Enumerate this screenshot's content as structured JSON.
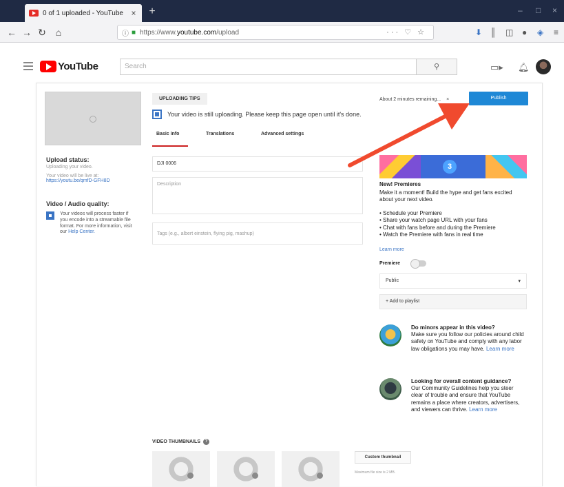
{
  "browser": {
    "tab_title": "0 of 1 uploaded - YouTube",
    "tab_close": "×",
    "new_tab": "+",
    "url_scheme": "https://www.",
    "url_host": "youtube.com",
    "url_path": "/upload",
    "url_tools": "··· ♡ ☆",
    "window_controls": [
      "–",
      "□",
      "×"
    ]
  },
  "yt_header": {
    "logo_text": "YouTube",
    "search_placeholder": "Search",
    "search_icon": "search-icon"
  },
  "left_panel": {
    "upload_status_label": "Upload status:",
    "upload_status_text": "Uploading your video.",
    "live_text": "Your video will be live at:",
    "live_link": "https://youtu.be/qmfD-GFH8D",
    "quality_title": "Video / Audio quality:",
    "quality_text": "Your videos will process faster if you encode into a streamable file format. For more information, visit our",
    "quality_link": "Help Center."
  },
  "upload": {
    "tip_label": "UPLOADING TIPS",
    "uploading_message": "Your video is still uploading. Please keep this page open until it's done.",
    "time_remaining": "About 2 minutes remaining...",
    "close_label": "×",
    "publish_label": "Publish",
    "tabs": [
      "Basic info",
      "Translations",
      "Advanced settings"
    ]
  },
  "form": {
    "title_value": "DJI 0006",
    "description_placeholder": "Description",
    "tags_placeholder": "Tags (e.g., albert einstein, flying pig, mashup)"
  },
  "premiere": {
    "banner_number": "3",
    "title": "New! Premieres",
    "description": "Make it a moment! Build the hype and get fans excited about your next video.",
    "items": [
      "• Schedule your Premiere",
      "• Share your watch page URL with your fans",
      "• Chat with fans before and during the Premiere",
      "• Watch the Premiere with fans in real time"
    ],
    "learn_more": "Learn more",
    "toggle_label": "Premiere",
    "privacy_value": "Public",
    "privacy_caret": "▾",
    "playlist_label": "+ Add to playlist"
  },
  "guides": [
    {
      "title": "Do minors appear in this video?",
      "text": "Make sure you follow our policies around child safety on YouTube and comply with any labor law obligations you may have.",
      "link": "Learn more"
    },
    {
      "title": "Looking for overall content guidance?",
      "text": "Our Community Guidelines help you steer clear of trouble and ensure that YouTube remains a place where creators, advertisers, and viewers can thrive.",
      "link": "Learn more"
    }
  ],
  "thumbnails": {
    "label": "VIDEO THUMBNAILS",
    "help": "?",
    "custom_button": "Custom thumbnail",
    "note": "Maximum file size is 2 MB."
  },
  "colors": {
    "accent_blue": "#1e88d6",
    "yt_red": "#ff0000",
    "arrow_red": "#f04a2e",
    "tab_underline": "#cc1f1f"
  }
}
